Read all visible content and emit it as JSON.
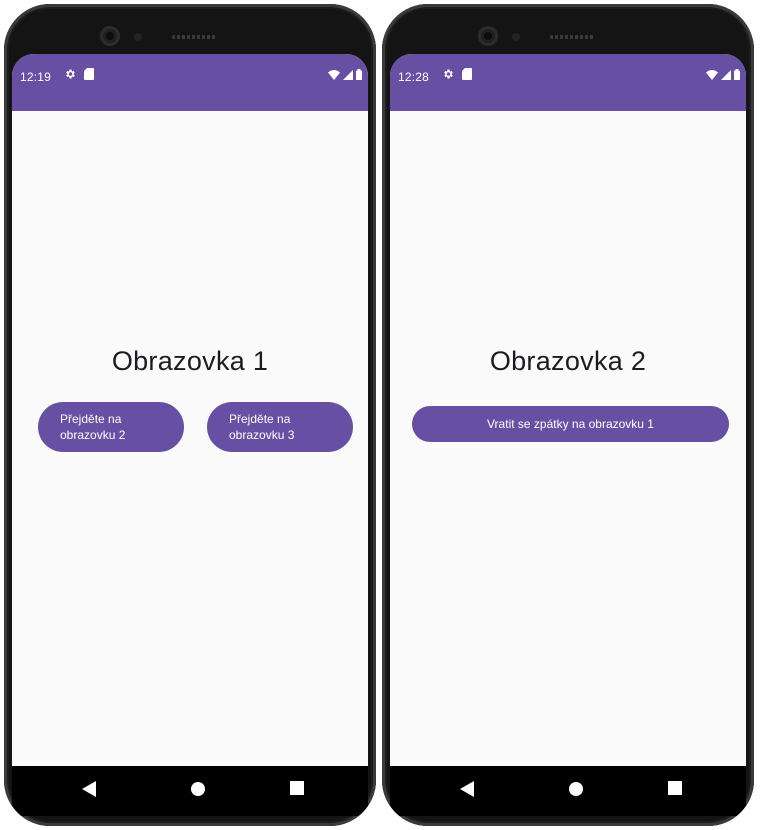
{
  "phones": [
    {
      "status_time": "12:19",
      "title": "Obrazovka 1",
      "buttons": [
        "Přejděte na obrazovku 2",
        "Přejděte na obrazovku 3"
      ]
    },
    {
      "status_time": "12:28",
      "title": "Obrazovka 2",
      "button": "Vratit se zpátky na obrazovku 1"
    }
  ],
  "colors": {
    "accent": "#6750a4",
    "screen_background": "#fafafa",
    "nav_bar": "#000000"
  },
  "icons": {
    "status_left": [
      "gear-icon",
      "sd-card-icon"
    ],
    "status_right": [
      "wifi-icon",
      "signal-icon",
      "battery-icon"
    ],
    "navigation": [
      "back-triangle-icon",
      "home-circle-icon",
      "recents-square-icon"
    ]
  }
}
